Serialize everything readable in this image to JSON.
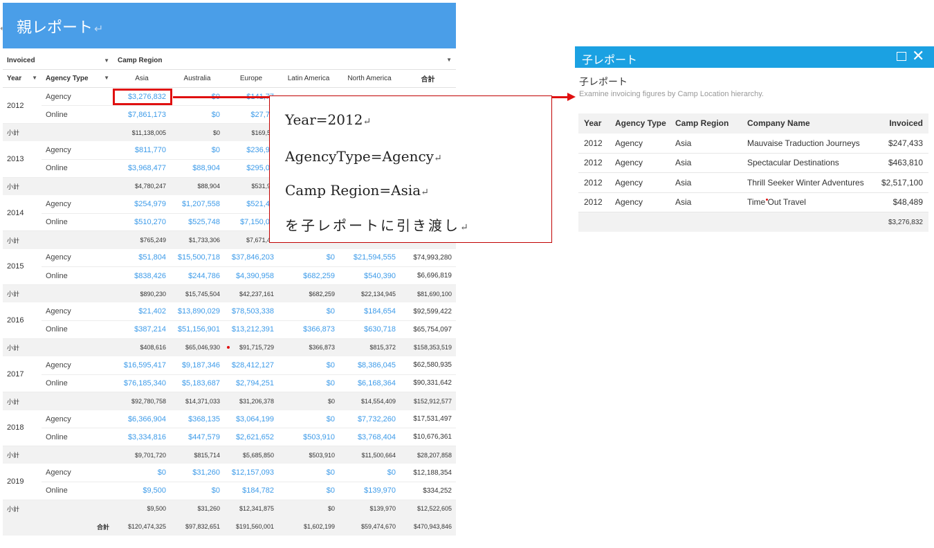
{
  "parent": {
    "title": "親レポート",
    "header": {
      "measure": "Invoiced",
      "column_dim": "Camp Region",
      "year_label": "Year",
      "agency_label": "Agency Type",
      "regions": [
        "Asia",
        "Australia",
        "Europe",
        "Latin America",
        "North America"
      ],
      "total_label": "合計"
    },
    "subtotal_label": "小計",
    "rows": [
      {
        "year": "2012",
        "agency": [
          {
            "type": "Agency",
            "values": [
              "$3,276,832",
              "$0",
              "$141,77",
              "",
              "",
              ""
            ]
          },
          {
            "type": "Online",
            "values": [
              "$7,861,173",
              "$0",
              "$27,75",
              "",
              "",
              ""
            ]
          }
        ],
        "subtotal": [
          "$11,138,005",
          "$0",
          "$169,52",
          "",
          "",
          ""
        ]
      },
      {
        "year": "2013",
        "agency": [
          {
            "type": "Agency",
            "values": [
              "$811,770",
              "$0",
              "$236,92",
              "",
              "",
              ""
            ]
          },
          {
            "type": "Online",
            "values": [
              "$3,968,477",
              "$88,904",
              "$295,06",
              "",
              "",
              ""
            ]
          }
        ],
        "subtotal": [
          "$4,780,247",
          "$88,904",
          "$531,99",
          "",
          "",
          ""
        ]
      },
      {
        "year": "2014",
        "agency": [
          {
            "type": "Agency",
            "values": [
              "$254,979",
              "$1,207,558",
              "$521,46",
              "",
              "",
              ""
            ]
          },
          {
            "type": "Online",
            "values": [
              "$510,270",
              "$525,748",
              "$7,150,02",
              "",
              "",
              ""
            ]
          }
        ],
        "subtotal": [
          "$765,249",
          "$1,733,306",
          "$7,671,48",
          "",
          "",
          ""
        ]
      },
      {
        "year": "2015",
        "agency": [
          {
            "type": "Agency",
            "values": [
              "$51,804",
              "$15,500,718",
              "$37,846,203",
              "$0",
              "$21,594,555",
              "$74,993,280"
            ]
          },
          {
            "type": "Online",
            "values": [
              "$838,426",
              "$244,786",
              "$4,390,958",
              "$682,259",
              "$540,390",
              "$6,696,819"
            ]
          }
        ],
        "subtotal": [
          "$890,230",
          "$15,745,504",
          "$42,237,161",
          "$682,259",
          "$22,134,945",
          "$81,690,100"
        ]
      },
      {
        "year": "2016",
        "agency": [
          {
            "type": "Agency",
            "values": [
              "$21,402",
              "$13,890,029",
              "$78,503,338",
              "$0",
              "$184,654",
              "$92,599,422"
            ]
          },
          {
            "type": "Online",
            "values": [
              "$387,214",
              "$51,156,901",
              "$13,212,391",
              "$366,873",
              "$630,718",
              "$65,754,097"
            ]
          }
        ],
        "subtotal": [
          "$408,616",
          "$65,046,930",
          "$91,715,729",
          "$366,873",
          "$815,372",
          "$158,353,519"
        ]
      },
      {
        "year": "2017",
        "agency": [
          {
            "type": "Agency",
            "values": [
              "$16,595,417",
              "$9,187,346",
              "$28,412,127",
              "$0",
              "$8,386,045",
              "$62,580,935"
            ]
          },
          {
            "type": "Online",
            "values": [
              "$76,185,340",
              "$5,183,687",
              "$2,794,251",
              "$0",
              "$6,168,364",
              "$90,331,642"
            ]
          }
        ],
        "subtotal": [
          "$92,780,758",
          "$14,371,033",
          "$31,206,378",
          "$0",
          "$14,554,409",
          "$152,912,577"
        ]
      },
      {
        "year": "2018",
        "agency": [
          {
            "type": "Agency",
            "values": [
              "$6,366,904",
              "$368,135",
              "$3,064,199",
              "$0",
              "$7,732,260",
              "$17,531,497"
            ]
          },
          {
            "type": "Online",
            "values": [
              "$3,334,816",
              "$447,579",
              "$2,621,652",
              "$503,910",
              "$3,768,404",
              "$10,676,361"
            ]
          }
        ],
        "subtotal": [
          "$9,701,720",
          "$815,714",
          "$5,685,850",
          "$503,910",
          "$11,500,664",
          "$28,207,858"
        ]
      },
      {
        "year": "2019",
        "agency": [
          {
            "type": "Agency",
            "values": [
              "$0",
              "$31,260",
              "$12,157,093",
              "$0",
              "$0",
              "$12,188,354"
            ]
          },
          {
            "type": "Online",
            "values": [
              "$9,500",
              "$0",
              "$184,782",
              "$0",
              "$139,970",
              "$334,252"
            ]
          }
        ],
        "subtotal": [
          "$9,500",
          "$31,260",
          "$12,341,875",
          "$0",
          "$139,970",
          "$12,522,605"
        ]
      }
    ],
    "grand_total_label": "合計",
    "grand_total": [
      "$120,474,325",
      "$97,832,651",
      "$191,560,001",
      "$1,602,199",
      "$59,474,670",
      "$470,943,846"
    ]
  },
  "callout": {
    "lines": [
      "Year=2012",
      "AgencyType=Agency",
      "Camp Region=Asia",
      "を子レポートに引き渡し"
    ],
    "return_mark": "↵"
  },
  "child": {
    "window_title": "子レポート",
    "subtitle": "子レポート",
    "description": "Examine invoicing figures by Camp Location hierarchy.",
    "columns": [
      "Year",
      "Agency Type",
      "Camp Region",
      "Company Name",
      "Invoiced"
    ],
    "rows": [
      [
        "2012",
        "Agency",
        "Asia",
        "Mauvaise Traduction Journeys",
        "$247,433"
      ],
      [
        "2012",
        "Agency",
        "Asia",
        "Spectacular Destinations",
        "$463,810"
      ],
      [
        "2012",
        "Agency",
        "Asia",
        "Thrill Seeker Winter Adventures",
        "$2,517,100"
      ],
      [
        "2012",
        "Agency",
        "Asia",
        "Time Out Travel",
        "$48,489"
      ]
    ],
    "total": "$3,276,832"
  },
  "colors": {
    "parent_header": "#4a9ee8",
    "child_header": "#1ba1e2",
    "link": "#3d9be9",
    "highlight": "#e01010"
  }
}
